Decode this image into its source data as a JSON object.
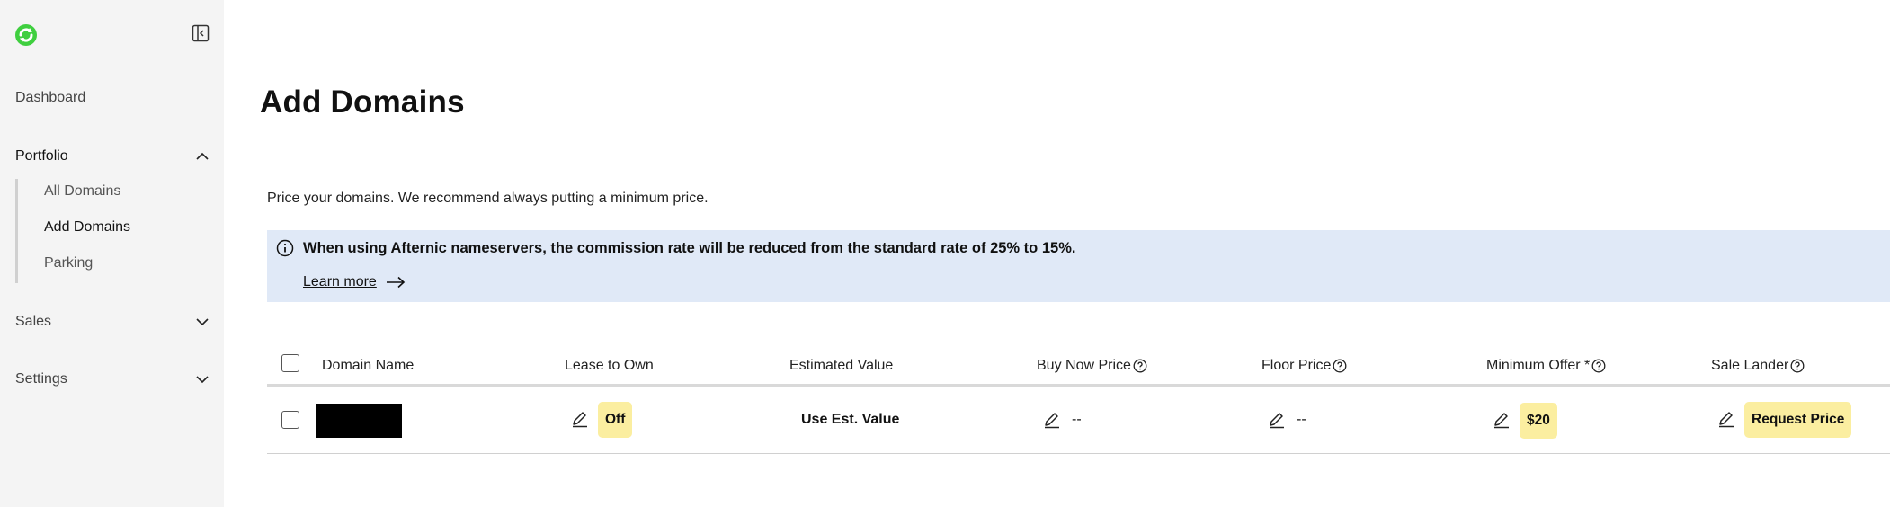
{
  "sidebar": {
    "nav": {
      "dashboard": "Dashboard",
      "portfolio": "Portfolio",
      "sales": "Sales",
      "settings": "Settings"
    },
    "portfolio_items": [
      "All Domains",
      "Add Domains",
      "Parking"
    ],
    "active_item": "Add Domains"
  },
  "main": {
    "title": "Add Domains",
    "subtitle": "Price your domains. We recommend always putting a minimum price.",
    "banner": {
      "text": "When using Afternic nameservers, the commission rate will be reduced from the standard rate of 25% to 15%.",
      "link": "Learn more"
    },
    "table": {
      "headers": {
        "domain_name": "Domain Name",
        "lease_to_own": "Lease to Own",
        "estimated_value": "Estimated Value",
        "buy_now_price": "Buy Now Price",
        "floor_price": "Floor Price",
        "minimum_offer": "Minimum Offer *",
        "sale_lander": "Sale Lander"
      },
      "rows": [
        {
          "lease_to_own": "Off",
          "estimated_value": "Use Est. Value",
          "buy_now_price": "--",
          "floor_price": "--",
          "minimum_offer": "$20",
          "sale_lander": "Request Price"
        }
      ]
    }
  },
  "colors": {
    "sidebar_bg": "#f4f4f4",
    "banner_bg": "#e0e9f7",
    "pill_bg": "#fbeea0",
    "logo_green": "#3fcf3f"
  }
}
